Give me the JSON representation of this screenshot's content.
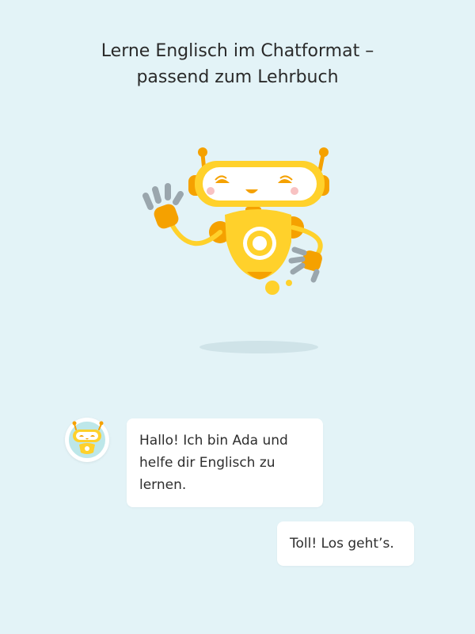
{
  "header": {
    "title_line1": "Lerne Englisch im Chatformat –",
    "title_line2": "passend zum Lehrbuch"
  },
  "mascot": {
    "name": "Ada",
    "icon": "robot-mascot",
    "colors": {
      "body": "#ffd12b",
      "accent": "#f5a100",
      "hand": "#9aa6ad",
      "eye": "#f5a100",
      "cheek": "#f8c2c2"
    }
  },
  "chat": {
    "bot_message": "Hallo! Ich bin Ada und helfe dir Englisch zu lernen.",
    "user_message": "Toll! Los geht’s."
  },
  "colors": {
    "background": "#e3f3f7",
    "bubble": "#ffffff"
  }
}
